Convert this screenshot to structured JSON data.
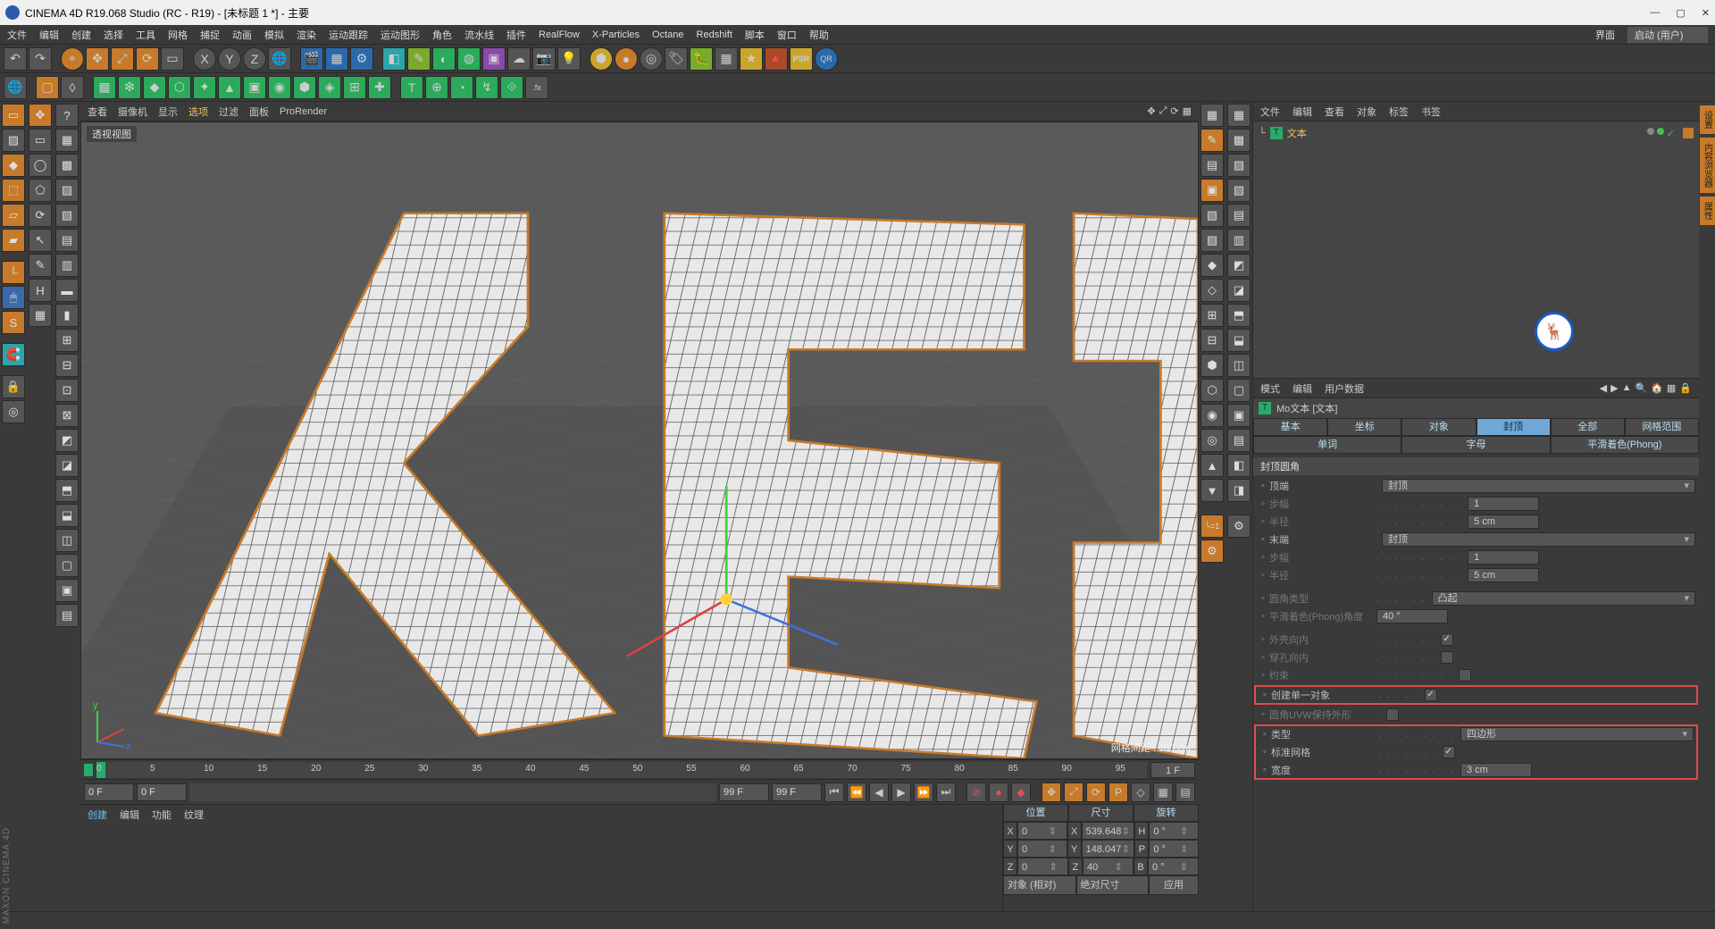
{
  "title": "CINEMA 4D R19.068 Studio (RC - R19) - [未标题 1 *] - 主要",
  "menubar": [
    "文件",
    "编辑",
    "创建",
    "选择",
    "工具",
    "网格",
    "捕捉",
    "动画",
    "模拟",
    "渲染",
    "运动跟踪",
    "运动图形",
    "角色",
    "流水线",
    "插件",
    "RealFlow",
    "X-Particles",
    "Octane",
    "Redshift",
    "脚本",
    "窗口",
    "帮助"
  ],
  "layout_label": "界面",
  "layout_value": "启动 (用户)",
  "vp_menu": [
    "查看",
    "摄像机",
    "显示",
    "选项",
    "过滤",
    "面板",
    "ProRender"
  ],
  "vp_menu_active_index": 3,
  "vp_name": "透视视图",
  "vp_grid_spacing": "网格间距 : 100 cm",
  "timeline": {
    "ticks": [
      0,
      5,
      10,
      15,
      20,
      25,
      30,
      35,
      40,
      45,
      50,
      55,
      60,
      65,
      70,
      75,
      80,
      85,
      90,
      95
    ],
    "current": "1 F",
    "start": "0 F",
    "startB": "0 F",
    "end": "99 F",
    "endB": "99 F"
  },
  "bottom_tabs": [
    "创建",
    "编辑",
    "功能",
    "纹理"
  ],
  "coord": {
    "headers": [
      "位置",
      "尺寸",
      "旋转"
    ],
    "rows": [
      {
        "axis": "X",
        "pos": "0 cm",
        "size": "539.648 cm",
        "szlabel": "H",
        "rot": "0 °"
      },
      {
        "axis": "Y",
        "pos": "0 cm",
        "size": "148.047 cm",
        "szlabel": "P",
        "rot": "0 °"
      },
      {
        "axis": "Z",
        "pos": "0 cm",
        "size": "40 cm",
        "szlabel": "B",
        "rot": "0 °"
      }
    ],
    "mode_left": "对象 (相对)",
    "mode_mid": "绝对尺寸",
    "apply": "应用"
  },
  "objmgr_menu": [
    "文件",
    "编辑",
    "查看",
    "对象",
    "标签",
    "书签"
  ],
  "obj_tree": {
    "name": "文本"
  },
  "attr_head": [
    "模式",
    "编辑",
    "用户数据"
  ],
  "attr_title": "Mo文本 [文本]",
  "attr_tabs_row1": [
    "基本",
    "坐标",
    "对象",
    "封顶",
    "全部",
    "网格范围"
  ],
  "attr_tabs_row2": [
    "单词",
    "字母",
    "平滑着色(Phong)"
  ],
  "attr_active_tab": "封顶",
  "attr_group": "封顶圆角",
  "attrs": {
    "top_cap_label": "顶端",
    "top_cap": "封顶",
    "steps_label": "步幅",
    "steps": "1",
    "radius_label": "半径",
    "radius": "5 cm",
    "end_cap_label": "末端",
    "end_cap": "封顶",
    "steps2_label": "步幅",
    "steps2": "1",
    "radius2_label": "半径",
    "radius2": "5 cm",
    "fillet_type_label": "圆角类型",
    "fillet_type": "凸起",
    "phong_angle_label": "平滑着色(Phong)角度",
    "phong_angle": "40 °",
    "shell_in_label": "外壳向内",
    "shell_in": true,
    "hole_in_label": "穿孔向内",
    "hole_in": false,
    "constrain_label": "约束",
    "constrain": false,
    "single_obj_label": "创建单一对象",
    "single_obj": true,
    "uvw_label": "圆角UVW保持外形",
    "uvw": false,
    "type_label": "类型",
    "type_val": "四边形",
    "std_grid_label": "标准网格",
    "std_grid": true,
    "width_label": "宽度",
    "width": "3 cm"
  },
  "vtabs": [
    "设置",
    "内容浏览器",
    "属性"
  ],
  "maxon": "MAXON CINEMA 4D"
}
